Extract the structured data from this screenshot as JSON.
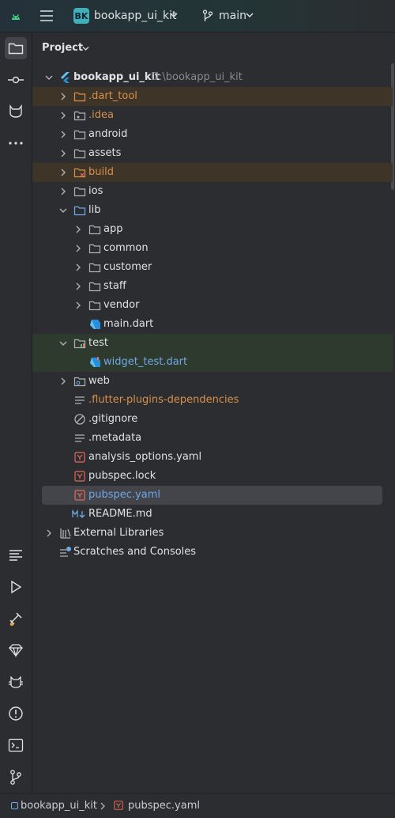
{
  "titlebar": {
    "project_badge": "BK",
    "project_name": "bookapp_ui_kit",
    "branch": "main"
  },
  "panel": {
    "title": "Project"
  },
  "tree": {
    "root": {
      "name": "bookapp_ui_kit",
      "path": "D:\\bookapp_ui_kit"
    },
    "items": [
      {
        "label": "bookapp_ui_kit"
      },
      {
        "label": ".dart_tool"
      },
      {
        "label": ".idea"
      },
      {
        "label": "android"
      },
      {
        "label": "assets"
      },
      {
        "label": "build"
      },
      {
        "label": "ios"
      },
      {
        "label": "lib"
      },
      {
        "label": "app"
      },
      {
        "label": "common"
      },
      {
        "label": "customer"
      },
      {
        "label": "staff"
      },
      {
        "label": "vendor"
      },
      {
        "label": "main.dart"
      },
      {
        "label": "test"
      },
      {
        "label": "widget_test.dart"
      },
      {
        "label": "web"
      },
      {
        "label": ".flutter-plugins-dependencies"
      },
      {
        "label": ".gitignore"
      },
      {
        "label": ".metadata"
      },
      {
        "label": "analysis_options.yaml"
      },
      {
        "label": "pubspec.lock"
      },
      {
        "label": "pubspec.yaml"
      },
      {
        "label": "README.md"
      },
      {
        "label": "External Libraries"
      },
      {
        "label": "Scratches and Consoles"
      }
    ]
  },
  "breadcrumb": {
    "project": "bookapp_ui_kit",
    "file": "pubspec.yaml"
  },
  "colors": {
    "excluded_folder": "#d9904a",
    "test_source": "#6fa7e8",
    "accent_selected": "#43454a"
  }
}
